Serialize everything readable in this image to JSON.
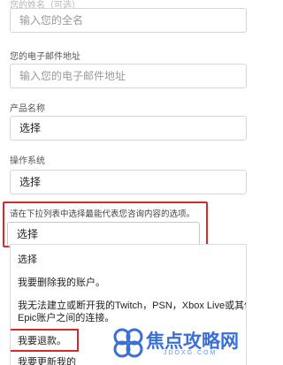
{
  "form": {
    "name_label": "您的姓名（可选）",
    "name_placeholder": "输入您的全名",
    "email_label": "您的电子邮件地址",
    "email_placeholder": "输入您的电子邮件地址",
    "product_label": "产品名称",
    "product_value": "选择",
    "os_label": "操作系统",
    "os_value": "选择",
    "topic_label": "请在下拉列表中选择最能代表您咨询内容的选项。",
    "topic_value": "选择"
  },
  "dropdown": {
    "options": [
      "选择",
      "我要删除我的账户。",
      "我无法建立或断开我的Twitch，PSN，Xbox Live或其他",
      "Epic账户之间的连接。",
      "我要退款。",
      "我要更新我的"
    ]
  },
  "watermark": {
    "brand": "焦点攻略网",
    "sub": "JDOXG.COM"
  },
  "colors": {
    "highlight": "#d62a2a",
    "border": "#d6d6d6",
    "watermark": "#3a6fd8"
  }
}
